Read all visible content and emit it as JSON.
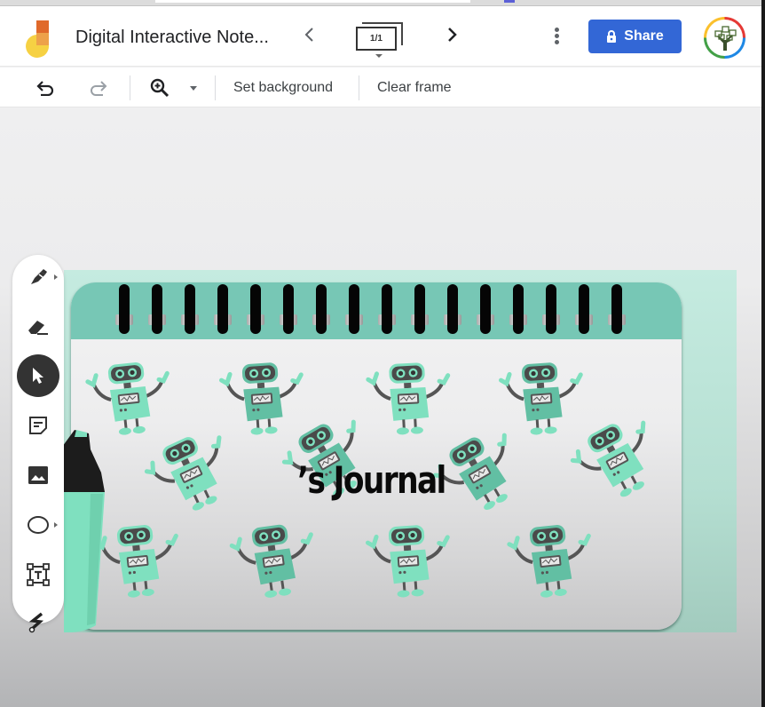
{
  "app": {
    "name": "Jamboard",
    "doc_title": "Digital Interactive Note...",
    "frame_counter": "1/1",
    "share_label": "Share",
    "icons": {
      "logo": "jamboard-logo",
      "prev": "chevron-left-icon",
      "next": "chevron-right-icon",
      "more": "more-vert-icon",
      "lock": "lock-icon",
      "avatar": "tree-avatar"
    },
    "share_color": "#3367d6"
  },
  "toolbar": {
    "undo": "undo-icon",
    "redo": "redo-icon",
    "zoom": "zoom-in-icon",
    "set_background_label": "Set background",
    "clear_frame_label": "Clear frame"
  },
  "tools": [
    {
      "name": "pen",
      "icon": "pen-icon",
      "has_submenu": true,
      "active": false
    },
    {
      "name": "eraser",
      "icon": "eraser-icon",
      "has_submenu": false,
      "active": false
    },
    {
      "name": "select",
      "icon": "pointer-icon",
      "has_submenu": false,
      "active": true
    },
    {
      "name": "sticky-note",
      "icon": "sticky-note-icon",
      "has_submenu": false,
      "active": false
    },
    {
      "name": "image",
      "icon": "image-icon",
      "has_submenu": false,
      "active": false
    },
    {
      "name": "shape",
      "icon": "circle-icon",
      "has_submenu": true,
      "active": false
    },
    {
      "name": "text-box",
      "icon": "text-box-icon",
      "has_submenu": false,
      "active": false
    },
    {
      "name": "laser",
      "icon": "laser-icon",
      "has_submenu": false,
      "active": false
    }
  ],
  "canvas": {
    "journal_title": "’s Journal",
    "spiral_ring_count": 16,
    "robot_count": 12,
    "colors": {
      "frame": "#c5ebe0",
      "notebook_header": "#77c7b5",
      "robot_light": "#7fe0bf",
      "robot_dark": "#62bfa3",
      "robot_head": "#4a4a4a"
    }
  }
}
